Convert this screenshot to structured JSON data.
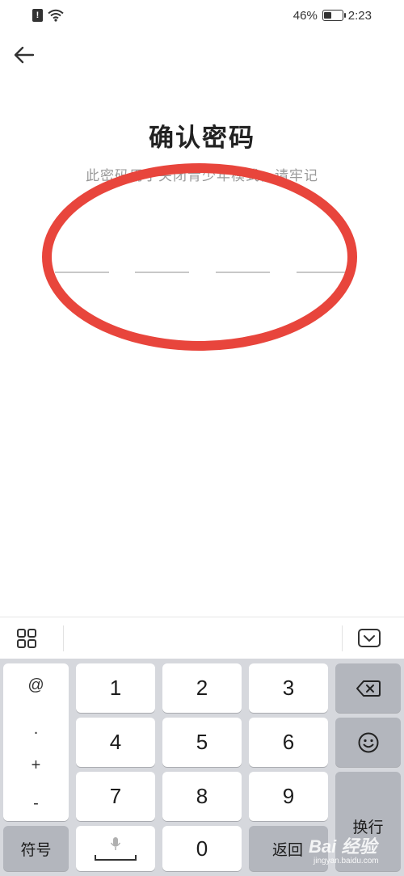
{
  "status_bar": {
    "battery_percent": "46%",
    "battery_level": 0.46,
    "time": "2:23",
    "icons": [
      "sim-alert-icon",
      "wifi-icon",
      "battery-icon"
    ]
  },
  "header": {
    "back_icon": "arrow-left-icon",
    "title": "确认密码",
    "subtitle": "此密码用于关闭青少年模式，请牢记"
  },
  "pin": {
    "length": 4,
    "entered": 0
  },
  "keyboard_toolbar": {
    "left_icon": "grid-icon",
    "right_icon": "keyboard-hide-icon"
  },
  "keyboard": {
    "symbols": [
      "@",
      ".",
      "+",
      "-"
    ],
    "digits": [
      "1",
      "2",
      "3",
      "4",
      "5",
      "6",
      "7",
      "8",
      "9"
    ],
    "zero": "0",
    "symbol_key": "符号",
    "space_icon": "microphone-icon",
    "return_key": "返回",
    "newline_key": "换行",
    "backspace_icon": "backspace-icon",
    "emoji_icon": "emoji-icon"
  },
  "watermark": {
    "text": "Bai 经验",
    "sub": "jingyan.baidu.com"
  },
  "colors": {
    "annotation": "#e8453c",
    "keyboard_bg": "#d6d8dd",
    "key_dark": "#b3b6bd",
    "subtitle": "#9a9a9a"
  }
}
